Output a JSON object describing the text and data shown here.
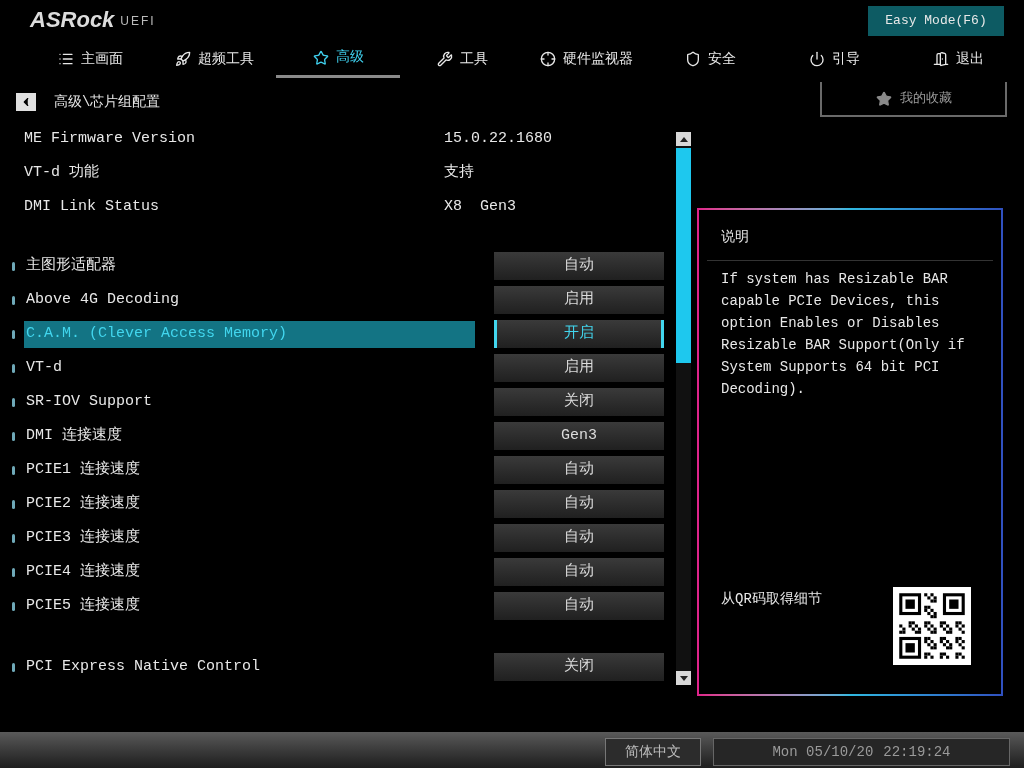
{
  "header": {
    "logo": "ASRock",
    "logo_suffix": "UEFI",
    "easy_mode_button": "Easy Mode(F6)"
  },
  "tabs": [
    {
      "label": "主画面",
      "selected": false
    },
    {
      "label": "超频工具",
      "selected": false
    },
    {
      "label": "高级",
      "selected": true
    },
    {
      "label": "工具",
      "selected": false
    },
    {
      "label": "硬件监视器",
      "selected": false
    },
    {
      "label": "安全",
      "selected": false
    },
    {
      "label": "引导",
      "selected": false
    },
    {
      "label": "退出",
      "selected": false
    }
  ],
  "breadcrumb": "高级\\芯片组配置",
  "favorites": "我的收藏",
  "info": [
    {
      "label": "ME Firmware Version",
      "value": "15.0.22.1680"
    },
    {
      "label": "VT-d 功能",
      "value": "支持"
    },
    {
      "label": "DMI Link Status",
      "value": "X8  Gen3"
    }
  ],
  "settings": [
    {
      "kind": "option",
      "label": "主图形适配器",
      "value": "自动",
      "selected": false
    },
    {
      "kind": "option",
      "label": "Above 4G Decoding",
      "value": "启用",
      "selected": false
    },
    {
      "kind": "option",
      "label": "C.A.M. (Clever Access Memory)",
      "value": "开启",
      "selected": true
    },
    {
      "kind": "option",
      "label": "VT-d",
      "value": "启用",
      "selected": false
    },
    {
      "kind": "option",
      "label": "SR-IOV Support",
      "value": "关闭",
      "selected": false
    },
    {
      "kind": "option",
      "label": "DMI 连接速度",
      "value": "Gen3",
      "selected": false
    },
    {
      "kind": "option",
      "label": "PCIE1 连接速度",
      "value": "自动",
      "selected": false
    },
    {
      "kind": "option",
      "label": "PCIE2 连接速度",
      "value": "自动",
      "selected": false
    },
    {
      "kind": "option",
      "label": "PCIE3 连接速度",
      "value": "自动",
      "selected": false
    },
    {
      "kind": "option",
      "label": "PCIE4 连接速度",
      "value": "自动",
      "selected": false
    },
    {
      "kind": "option",
      "label": "PCIE5 连接速度",
      "value": "自动",
      "selected": false
    },
    {
      "kind": "separated",
      "label": "PCI Express Native Control",
      "value": "关闭",
      "selected": false
    }
  ],
  "description": {
    "title": "说明",
    "text": "If system has Resizable BAR capable PCIe Devices, this option Enables or Disables Resizable BAR Support(Only if System Supports 64 bit PCI Decoding).",
    "qr_caption": "从QR码取得细节"
  },
  "status_bar": {
    "language": "简体中文",
    "date": "Mon 05/10/20",
    "time": "22:19:24"
  }
}
